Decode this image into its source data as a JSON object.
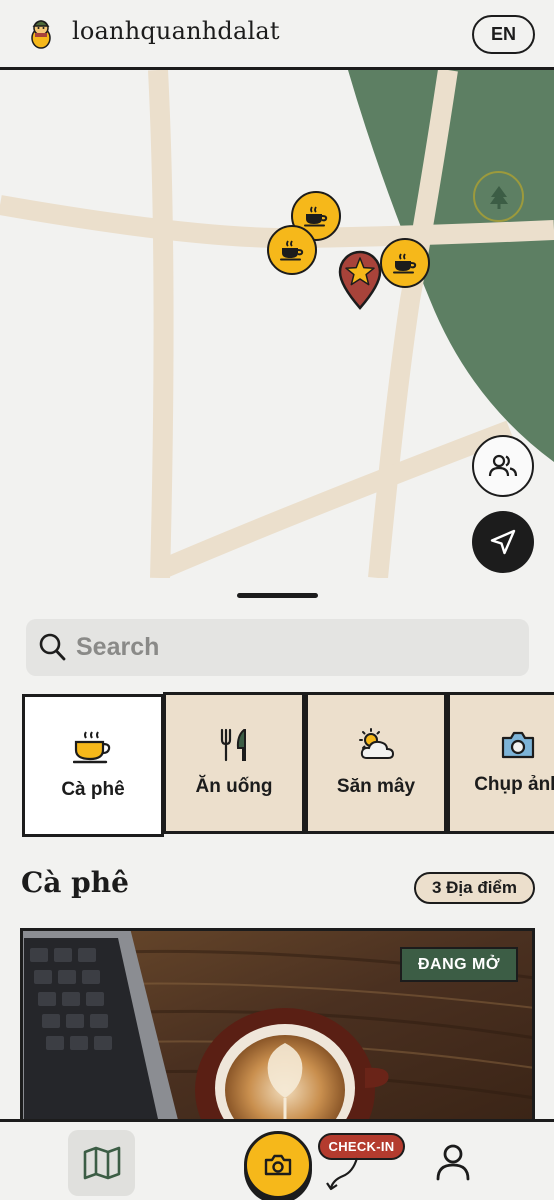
{
  "header": {
    "brand": "loanhquanhdalat",
    "lang_label": "EN"
  },
  "map": {
    "icons": [
      "tree-icon",
      "coffee-icon",
      "star-marker-icon",
      "group-icon",
      "navigate-icon"
    ],
    "colors": {
      "road": "#ebdfcc",
      "forest": "#5d7f63",
      "poi": "#f6b81a",
      "marker": "#a8433a"
    }
  },
  "search": {
    "placeholder": "Search",
    "value": ""
  },
  "categories": [
    {
      "label": "Cà phê",
      "icon": "coffee-cup-icon",
      "active": true
    },
    {
      "label": "Ăn uống",
      "icon": "fork-knife-icon",
      "active": false
    },
    {
      "label": "Săn mây",
      "icon": "sun-cloud-icon",
      "active": false
    },
    {
      "label": "Chụp ảnh",
      "icon": "camera-icon",
      "active": false
    }
  ],
  "section": {
    "title": "Cà phê",
    "count_label": "3 Địa điểm"
  },
  "card": {
    "status": "ĐANG MỞ"
  },
  "bottom_nav": {
    "checkin_label": "CHECK-IN",
    "items": [
      "map-icon",
      "camera-icon",
      "profile-icon"
    ]
  },
  "colors": {
    "accent_yellow": "#f6b81a",
    "open_green": "#3c5d45",
    "checkin_red": "#b43b2e",
    "category_bg": "#ecdfcc"
  }
}
